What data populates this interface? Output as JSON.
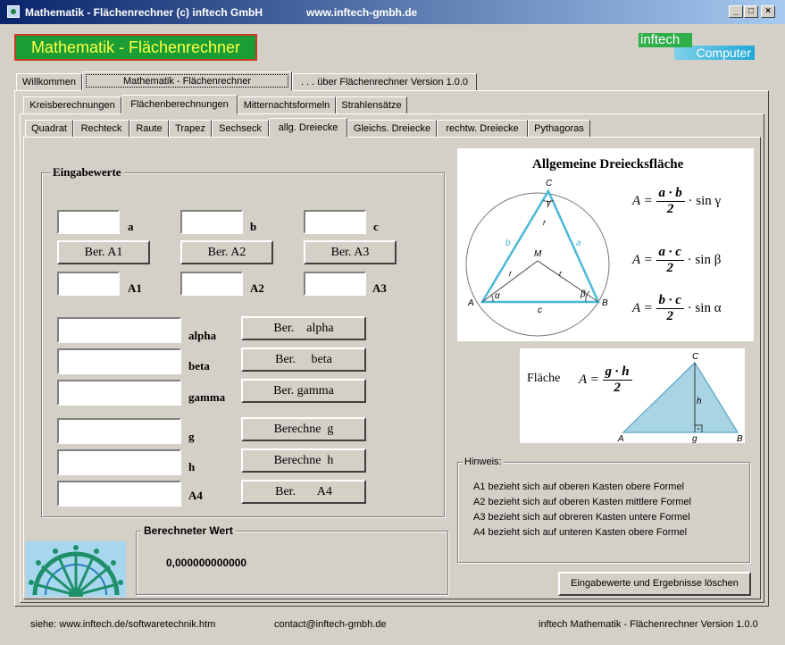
{
  "window": {
    "title": "Mathematik - Flächenrechner (c) inftech GmbH",
    "url": "www.inftech-gmbh.de",
    "controls": {
      "minimize": "_",
      "maximize": "□",
      "close": "×"
    }
  },
  "header": {
    "banner": "Mathematik - Flächenrechner",
    "logo_top": "inftech",
    "logo_bottom": "Computer"
  },
  "tabs_main": [
    "Willkommen",
    "Mathematik - Flächenrechner",
    ". . . über Flächenrechner Version 1.0.0"
  ],
  "tabs_calc": [
    "Kreisberechnungen",
    "Flächenberechnungen",
    "Mitternachtsformeln",
    "Strahlensätze"
  ],
  "tabs_shape": [
    "Quadrat",
    "Rechteck",
    "Raute",
    "Trapez",
    "Sechseck",
    "allg. Dreiecke",
    "Gleichs. Dreiecke",
    "rechtw. Dreiecke",
    "Pythagoras"
  ],
  "input_group": {
    "title": "Eingabewerte",
    "side_labels": [
      "a",
      "b",
      "c"
    ],
    "area_buttons": [
      "Ber. A1",
      "Ber. A2",
      "Ber. A3"
    ],
    "area_labels": [
      "A1",
      "A2",
      "A3"
    ],
    "angle_labels": [
      "alpha",
      "beta",
      "gamma"
    ],
    "angle_buttons": [
      "Ber.    alpha",
      "Ber.     beta",
      "Ber. gamma"
    ],
    "height_labels": [
      "g",
      "h",
      "A4"
    ],
    "height_buttons": [
      "Berechne  g",
      "Berechne  h",
      "Ber.       A4"
    ]
  },
  "result_group": {
    "title": "Berechneter Wert",
    "value": "0,000000000000"
  },
  "diagram_top": {
    "title": "Allgemeine Dreiecksfläche",
    "vertex_labels": [
      "C",
      "A",
      "B",
      "M"
    ],
    "side_labels": [
      "b",
      "a",
      "c",
      "r",
      "r",
      "r"
    ],
    "angle_labels": [
      "γ",
      "α",
      "β"
    ],
    "formulas": [
      {
        "lhs": "A =",
        "num": "a · b",
        "den": "2",
        "rhs": "· sin γ"
      },
      {
        "lhs": "A =",
        "num": "a · c",
        "den": "2",
        "rhs": "· sin β"
      },
      {
        "lhs": "A =",
        "num": "b · c",
        "den": "2",
        "rhs": "· sin α"
      }
    ]
  },
  "diagram_bottom": {
    "label": "Fläche",
    "lhs": "A =",
    "num": "g · h",
    "den": "2",
    "vertex_labels": [
      "C",
      "A",
      "B",
      "g",
      "h"
    ]
  },
  "hinweis": {
    "title": "Hinweis:",
    "lines": [
      "A1 bezieht sich auf oberen Kasten obere Formel",
      "A2 bezieht sich auf oberen Kasten mittlere Formel",
      "A3 bezieht sich auf obreren Kasten untere Formel",
      "A4 bezieht sich auf unteren Kasten obere Formel"
    ]
  },
  "clear_button": "Eingabewerte und Ergebnisse löschen",
  "status": {
    "left": "siehe: www.inftech.de/softwaretechnik.htm",
    "middle": "contact@inftech-gmbh.de",
    "right": "inftech Mathematik - Flächenrechner Version 1.0.0"
  },
  "colors": {
    "window_bg": "#d4d0c8",
    "titlebar_start": "#0a246a",
    "banner_green": "#1a9d34",
    "banner_border": "#c83a20",
    "triangle_cyan": "#4ab8d8"
  }
}
